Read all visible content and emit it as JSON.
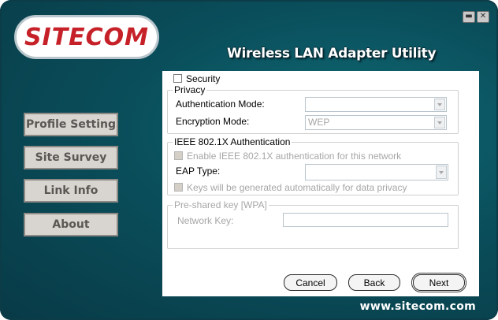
{
  "window": {
    "app_title": "Wireless LAN Adapter Utility",
    "logo_text": "SITECOM",
    "footer_url": "www.sitecom.com",
    "minimize_glyph": "▬",
    "close_glyph": "✕"
  },
  "nav": {
    "items": [
      {
        "label": "Profile Setting"
      },
      {
        "label": "Site Survey"
      },
      {
        "label": "Link Info"
      },
      {
        "label": "About"
      }
    ]
  },
  "security": {
    "checkbox_label": "Security",
    "checked": false
  },
  "privacy": {
    "legend": "Privacy",
    "auth_mode_label": "Authentication Mode:",
    "auth_mode_value": "",
    "encryption_mode_label": "Encryption Mode:",
    "encryption_mode_value": "WEP"
  },
  "ieee": {
    "legend": "IEEE 802.1X Authentication",
    "enable_label": "Enable IEEE 802.1X authentication for this network",
    "eap_type_label": "EAP Type:",
    "eap_type_value": "",
    "keys_label": "Keys will be generated automatically for data privacy"
  },
  "psk": {
    "legend": "Pre-shared key [WPA]",
    "network_key_label": "Network Key:",
    "network_key_value": ""
  },
  "buttons": {
    "cancel": "Cancel",
    "back": "Back",
    "next": "Next"
  },
  "colors": {
    "background": "#0a4e5b",
    "logo_red": "#c62128",
    "nav_button": "#d8d4cf"
  }
}
